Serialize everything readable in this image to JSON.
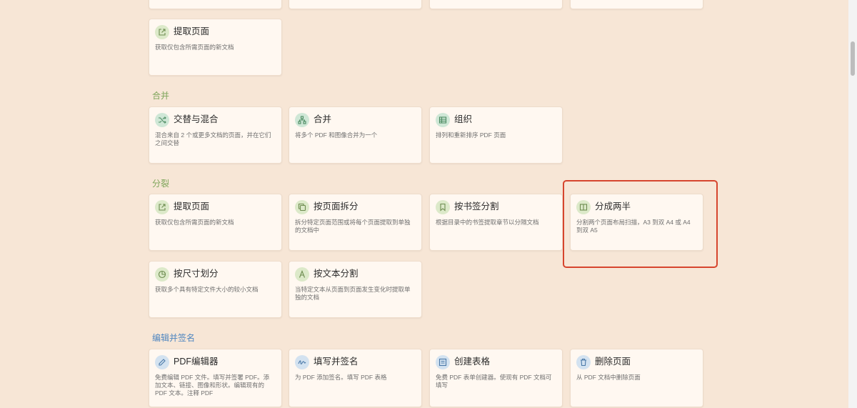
{
  "sections": {
    "merge": "合并",
    "split": "分裂",
    "edit_sign": "编辑并签名"
  },
  "cards": {
    "extract_top": {
      "title": "提取页面",
      "desc": "获取仅包含所需页面的新文档",
      "icon": "external-link-icon"
    },
    "alternate_mix": {
      "title": "交替与混合",
      "desc": "混合来自 2 个或更多文档的页面，并在它们之间交替",
      "icon": "shuffle-icon"
    },
    "merge": {
      "title": "合并",
      "desc": "将多个 PDF 和图像合并为一个",
      "icon": "merge-icon"
    },
    "organize": {
      "title": "组织",
      "desc": "排列和重新排序 PDF 页面",
      "icon": "organize-icon"
    },
    "extract_split": {
      "title": "提取页面",
      "desc": "获取仅包含所需页面的新文档",
      "icon": "external-link-icon"
    },
    "split_by_pages": {
      "title": "按页面拆分",
      "desc": "拆分特定页面范围或将每个页面提取到单独的文档中",
      "icon": "copy-icon"
    },
    "split_by_bookmarks": {
      "title": "按书签分割",
      "desc": "根据目录中的书签提取章节以分隔文档",
      "icon": "bookmark-icon"
    },
    "split_in_half": {
      "title": "分成两半",
      "desc": "分割两个页面布局扫描，A3 到双 A4 或 A4 到双 A5",
      "icon": "columns-icon"
    },
    "split_by_size": {
      "title": "按尺寸划分",
      "desc": "获取多个具有特定文件大小的较小文档",
      "icon": "pie-icon"
    },
    "split_by_text": {
      "title": "按文本分割",
      "desc": "当特定文本从页面到页面发生变化时提取单独的文档",
      "icon": "text-icon"
    },
    "pdf_editor": {
      "title": "PDF编辑器",
      "desc": "免费编辑 PDF 文件。填写并签署 PDF。添加文本、链接、图像和形状。编辑现有的 PDF 文本。注释 PDF",
      "icon": "pencil-icon"
    },
    "fill_sign": {
      "title": "填写并签名",
      "desc": "为 PDF 添加签名。填写 PDF 表格",
      "icon": "signature-icon"
    },
    "create_form": {
      "title": "创建表格",
      "desc": "免费 PDF 表单创建器。使现有 PDF 文档可填写",
      "icon": "form-icon"
    },
    "delete_pages": {
      "title": "删除页面",
      "desc": "从 PDF 文档中删除页面",
      "icon": "trash-icon"
    }
  }
}
